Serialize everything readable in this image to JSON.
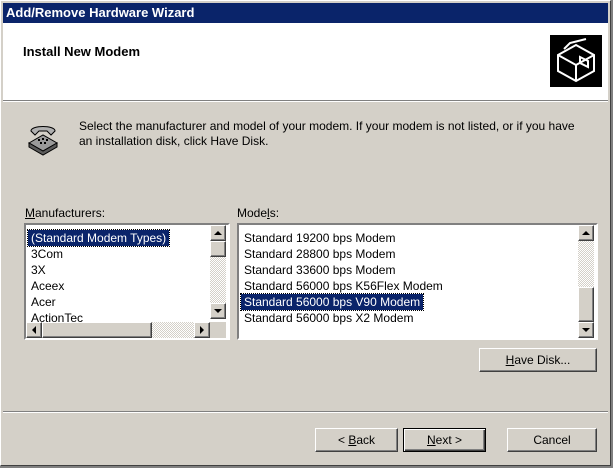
{
  "window": {
    "title": "Add/Remove Hardware Wizard"
  },
  "header": {
    "title": "Install New Modem",
    "icon": "hardware-wizard-icon"
  },
  "instructions": "Select the manufacturer and model of your modem. If your modem is not listed, or if you have an installation disk, click Have Disk.",
  "manufacturers": {
    "label_prefix": "",
    "label_accel": "M",
    "label_rest": "anufacturers:",
    "items": [
      "(Standard Modem Types)",
      "3Com",
      "3X",
      "Aceex",
      "Acer",
      "ActionTec"
    ],
    "selected_index": 0
  },
  "models": {
    "label_prefix": "Mode",
    "label_accel": "l",
    "label_rest": "s:",
    "items": [
      "Standard 19200 bps Modem",
      "Standard 28800 bps Modem",
      "Standard 33600 bps Modem",
      "Standard 56000 bps K56Flex Modem",
      "Standard 56000 bps V90 Modem",
      "Standard 56000 bps X2 Modem"
    ],
    "selected_index": 4
  },
  "buttons": {
    "have_disk": {
      "accel": "H",
      "rest": "ave Disk..."
    },
    "back": {
      "prefix": "< ",
      "accel": "B",
      "rest": "ack"
    },
    "next": {
      "prefix": "",
      "accel": "N",
      "rest": "ext >"
    },
    "cancel": "Cancel"
  },
  "colors": {
    "title_bar": "#0a246a",
    "selection": "#0a246a",
    "face": "#d4d0c8"
  }
}
